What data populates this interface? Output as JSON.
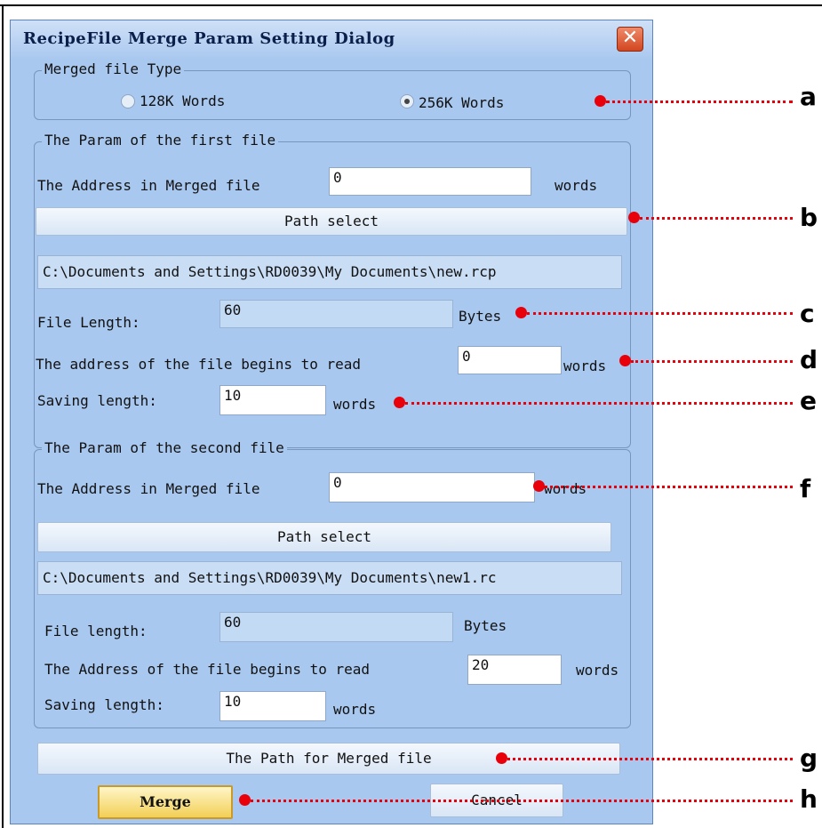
{
  "dialog": {
    "title": "RecipeFile Merge Param Setting Dialog",
    "close_glyph": "✕"
  },
  "merged_type": {
    "legend": "Merged file Type",
    "options": [
      {
        "label": "128K Words",
        "selected": false
      },
      {
        "label": "256K Words",
        "selected": true
      }
    ]
  },
  "first_file": {
    "legend": "The Param of the first file",
    "address_label": "The Address in Merged file",
    "address_value": "0",
    "address_unit": "words",
    "path_button": "Path select",
    "path_value": "C:\\Documents and Settings\\RD0039\\My Documents\\new.rcp",
    "length_label": "File Length:",
    "length_value": "60",
    "length_unit": "Bytes",
    "read_label": "The address of the file begins to read",
    "read_value": "0",
    "read_unit": "words",
    "saving_label": "Saving length:",
    "saving_value": "10",
    "saving_unit": "words"
  },
  "second_file": {
    "legend": "The Param of the second file",
    "address_label": "The Address in Merged file",
    "address_value": "0",
    "address_unit": "words",
    "path_button": "Path select",
    "path_value": "C:\\Documents and Settings\\RD0039\\My Documents\\new1.rc",
    "length_label": "File length:",
    "length_value": "60",
    "length_unit": "Bytes",
    "read_label": "The Address of the file begins to read",
    "read_value": "20",
    "read_unit": "words",
    "saving_label": "Saving length:",
    "saving_value": "10",
    "saving_unit": "words"
  },
  "merged_path_button": "The Path for Merged file",
  "actions": {
    "merge": "Merge",
    "cancel": "Cancel"
  },
  "callouts": [
    "a",
    "b",
    "c",
    "d",
    "e",
    "f",
    "g",
    "h"
  ],
  "colors": {
    "dialog_bg": "#a9c8ef",
    "callout_red": "#e8000b",
    "merge_button": "#f2cf55"
  }
}
